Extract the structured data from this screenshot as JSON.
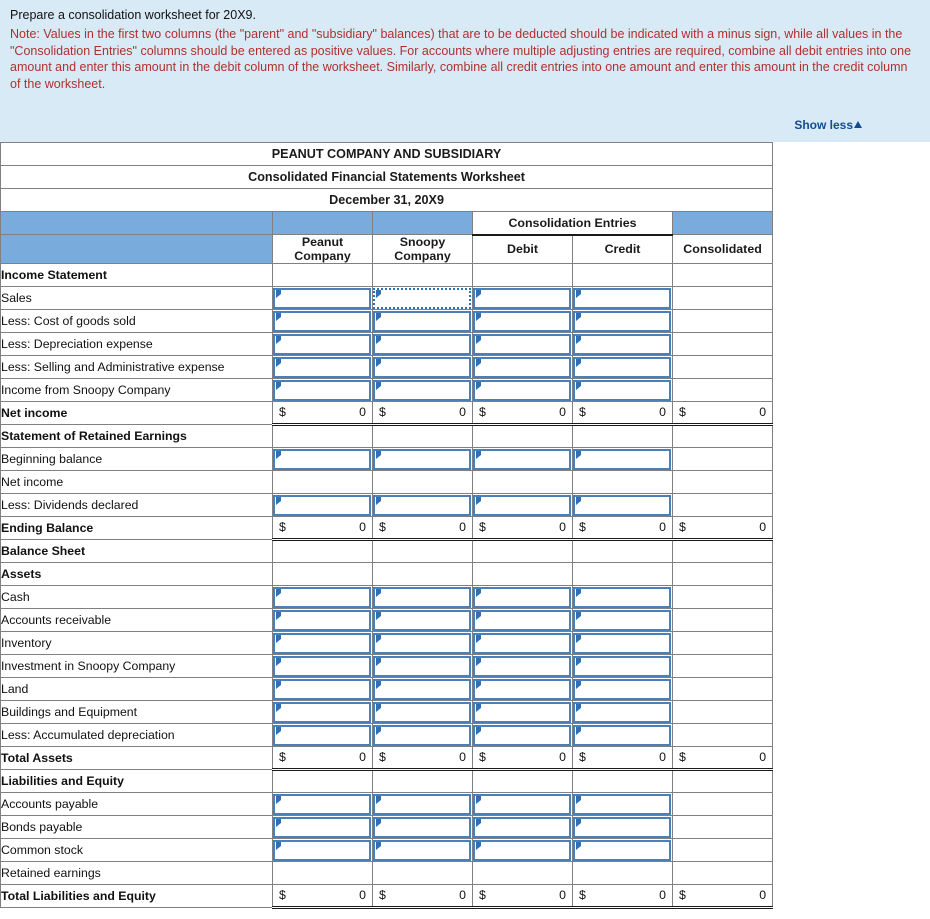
{
  "instructions": {
    "prompt": "Prepare a consolidation worksheet for 20X9.",
    "note": "Note: Values in the first two columns (the \"parent\" and \"subsidiary\" balances) that are to be deducted should be indicated with a minus sign, while all values in the \"Consolidation Entries\" columns should be entered as positive values. For accounts where multiple adjusting entries are required, combine all debit entries into one amount and enter this amount in the debit column of the worksheet. Similarly, combine all credit entries into one amount and enter this amount in the credit column of the worksheet.",
    "show_less_label": "Show less",
    "show_less_icon": "caret-up-icon",
    "panel_bg": "#d9eaf7",
    "note_color": "#b03030",
    "link_color": "#134b8e"
  },
  "worksheet": {
    "title_line1": "PEANUT COMPANY AND SUBSIDIARY",
    "title_line2": "Consolidated Financial Statements Worksheet",
    "title_line3": "December 31, 20X9",
    "header_bg": "#79abdd",
    "group_header": "Consolidation Entries",
    "columns": [
      {
        "key": "label",
        "label": ""
      },
      {
        "key": "peanut",
        "label": "Peanut Company",
        "line1": "Peanut",
        "line2": "Company"
      },
      {
        "key": "snoopy",
        "label": "Snoopy Company",
        "line1": "Snoopy",
        "line2": "Company"
      },
      {
        "key": "debit",
        "label": "Debit"
      },
      {
        "key": "credit",
        "label": "Credit"
      },
      {
        "key": "consolidated",
        "label": "Consolidated"
      }
    ],
    "dollar_sign": "$",
    "zero_value": "0",
    "rows": [
      {
        "label": "Income Statement",
        "type": "section"
      },
      {
        "label": "Sales",
        "type": "input"
      },
      {
        "label": "Less: Cost of goods sold",
        "type": "input"
      },
      {
        "label": "Less: Depreciation expense",
        "type": "input"
      },
      {
        "label": "Less: Selling and Administrative expense",
        "type": "input"
      },
      {
        "label": "Income from Snoopy Company",
        "type": "input"
      },
      {
        "label": "Net income",
        "type": "total"
      },
      {
        "label": "Statement of Retained Earnings",
        "type": "section"
      },
      {
        "label": "Beginning balance",
        "type": "input"
      },
      {
        "label": "Net income",
        "type": "blank"
      },
      {
        "label": "Less: Dividends declared",
        "type": "input"
      },
      {
        "label": "Ending Balance",
        "type": "total"
      },
      {
        "label": "Balance Sheet",
        "type": "section"
      },
      {
        "label": "Assets",
        "type": "section"
      },
      {
        "label": "Cash",
        "type": "input"
      },
      {
        "label": "Accounts receivable",
        "type": "input"
      },
      {
        "label": "Inventory",
        "type": "input"
      },
      {
        "label": "Investment in Snoopy Company",
        "type": "input"
      },
      {
        "label": "Land",
        "type": "input"
      },
      {
        "label": "Buildings and Equipment",
        "type": "input"
      },
      {
        "label": "Less: Accumulated depreciation",
        "type": "input"
      },
      {
        "label": "Total Assets",
        "type": "total"
      },
      {
        "label": "Liabilities and Equity",
        "type": "section"
      },
      {
        "label": "Accounts payable",
        "type": "input"
      },
      {
        "label": "Bonds payable",
        "type": "input"
      },
      {
        "label": "Common stock",
        "type": "input"
      },
      {
        "label": "Retained earnings",
        "type": "blank"
      },
      {
        "label": "Total Liabilities and Equity",
        "type": "total"
      }
    ],
    "input_values": {
      "default": ""
    },
    "focused_cell": {
      "row_index": 1,
      "column": "snoopy"
    }
  }
}
